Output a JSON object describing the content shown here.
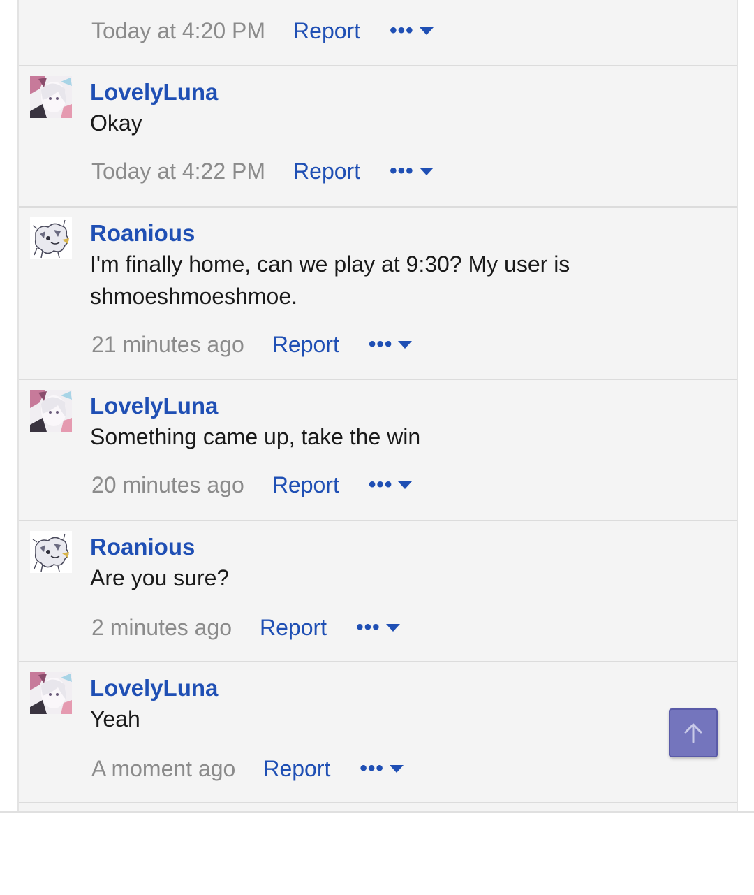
{
  "posts": [
    {
      "username": "",
      "avatar": "",
      "body": "",
      "timestamp": "Today at 4:20 PM",
      "report_label": "Report",
      "more_label": "•••"
    },
    {
      "username": "LovelyLuna",
      "avatar": "anime-girl-avatar",
      "body": "Okay",
      "timestamp": "Today at 4:22 PM",
      "report_label": "Report",
      "more_label": "•••"
    },
    {
      "username": "Roanious",
      "avatar": "creature-sketch-avatar",
      "body": "I'm finally home, can we play at 9:30? My user is shmoeshmoeshmoe.",
      "timestamp": "21 minutes ago",
      "report_label": "Report",
      "more_label": "•••"
    },
    {
      "username": "LovelyLuna",
      "avatar": "anime-girl-avatar",
      "body": "Something came up, take the win",
      "timestamp": "20 minutes ago",
      "report_label": "Report",
      "more_label": "•••"
    },
    {
      "username": "Roanious",
      "avatar": "creature-sketch-avatar",
      "body": "Are you sure?",
      "timestamp": "2 minutes ago",
      "report_label": "Report",
      "more_label": "•••"
    },
    {
      "username": "LovelyLuna",
      "avatar": "anime-girl-avatar",
      "body": "Yeah",
      "timestamp": "A moment ago",
      "report_label": "Report",
      "more_label": "•••"
    }
  ],
  "scroll_top_icon": "arrow-up-icon",
  "colors": {
    "link": "#1f4fb4",
    "timestamp": "#8b8b8b",
    "post_bg": "#f4f4f4",
    "scroll_button": "#7475bd"
  }
}
